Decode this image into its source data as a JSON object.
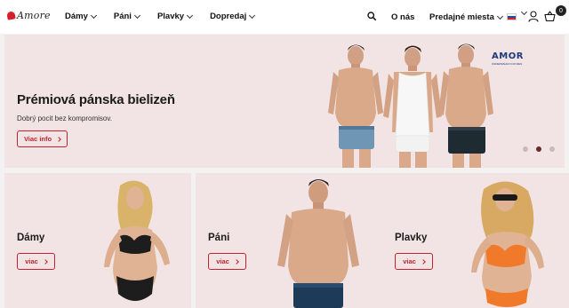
{
  "header": {
    "logo_text": "Amore",
    "nav": [
      {
        "label": "Dámy"
      },
      {
        "label": "Páni"
      },
      {
        "label": "Plavky"
      },
      {
        "label": "Dopredaj"
      }
    ],
    "about_label": "O nás",
    "stores_label": "Predajné miesta",
    "cart_count": "0"
  },
  "hero": {
    "title": "Prémiová pánska bielizeň",
    "subtitle": "Dobrý pocit bez kompromisov.",
    "button_label": "Viac info",
    "brand_logo": "AMOR",
    "brand_tagline": "UNDERWEAR FOR MEN",
    "slides": 3,
    "active_slide": 2
  },
  "cards": [
    {
      "title": "Dámy",
      "button_label": "viac"
    },
    {
      "title": "Páni",
      "button_label": "viac"
    },
    {
      "title": "Plavky",
      "button_label": "viac"
    }
  ],
  "colors": {
    "accent": "#c0232d",
    "hero_bg": "#f2e4e4",
    "page_bg": "#f3f1f1"
  }
}
